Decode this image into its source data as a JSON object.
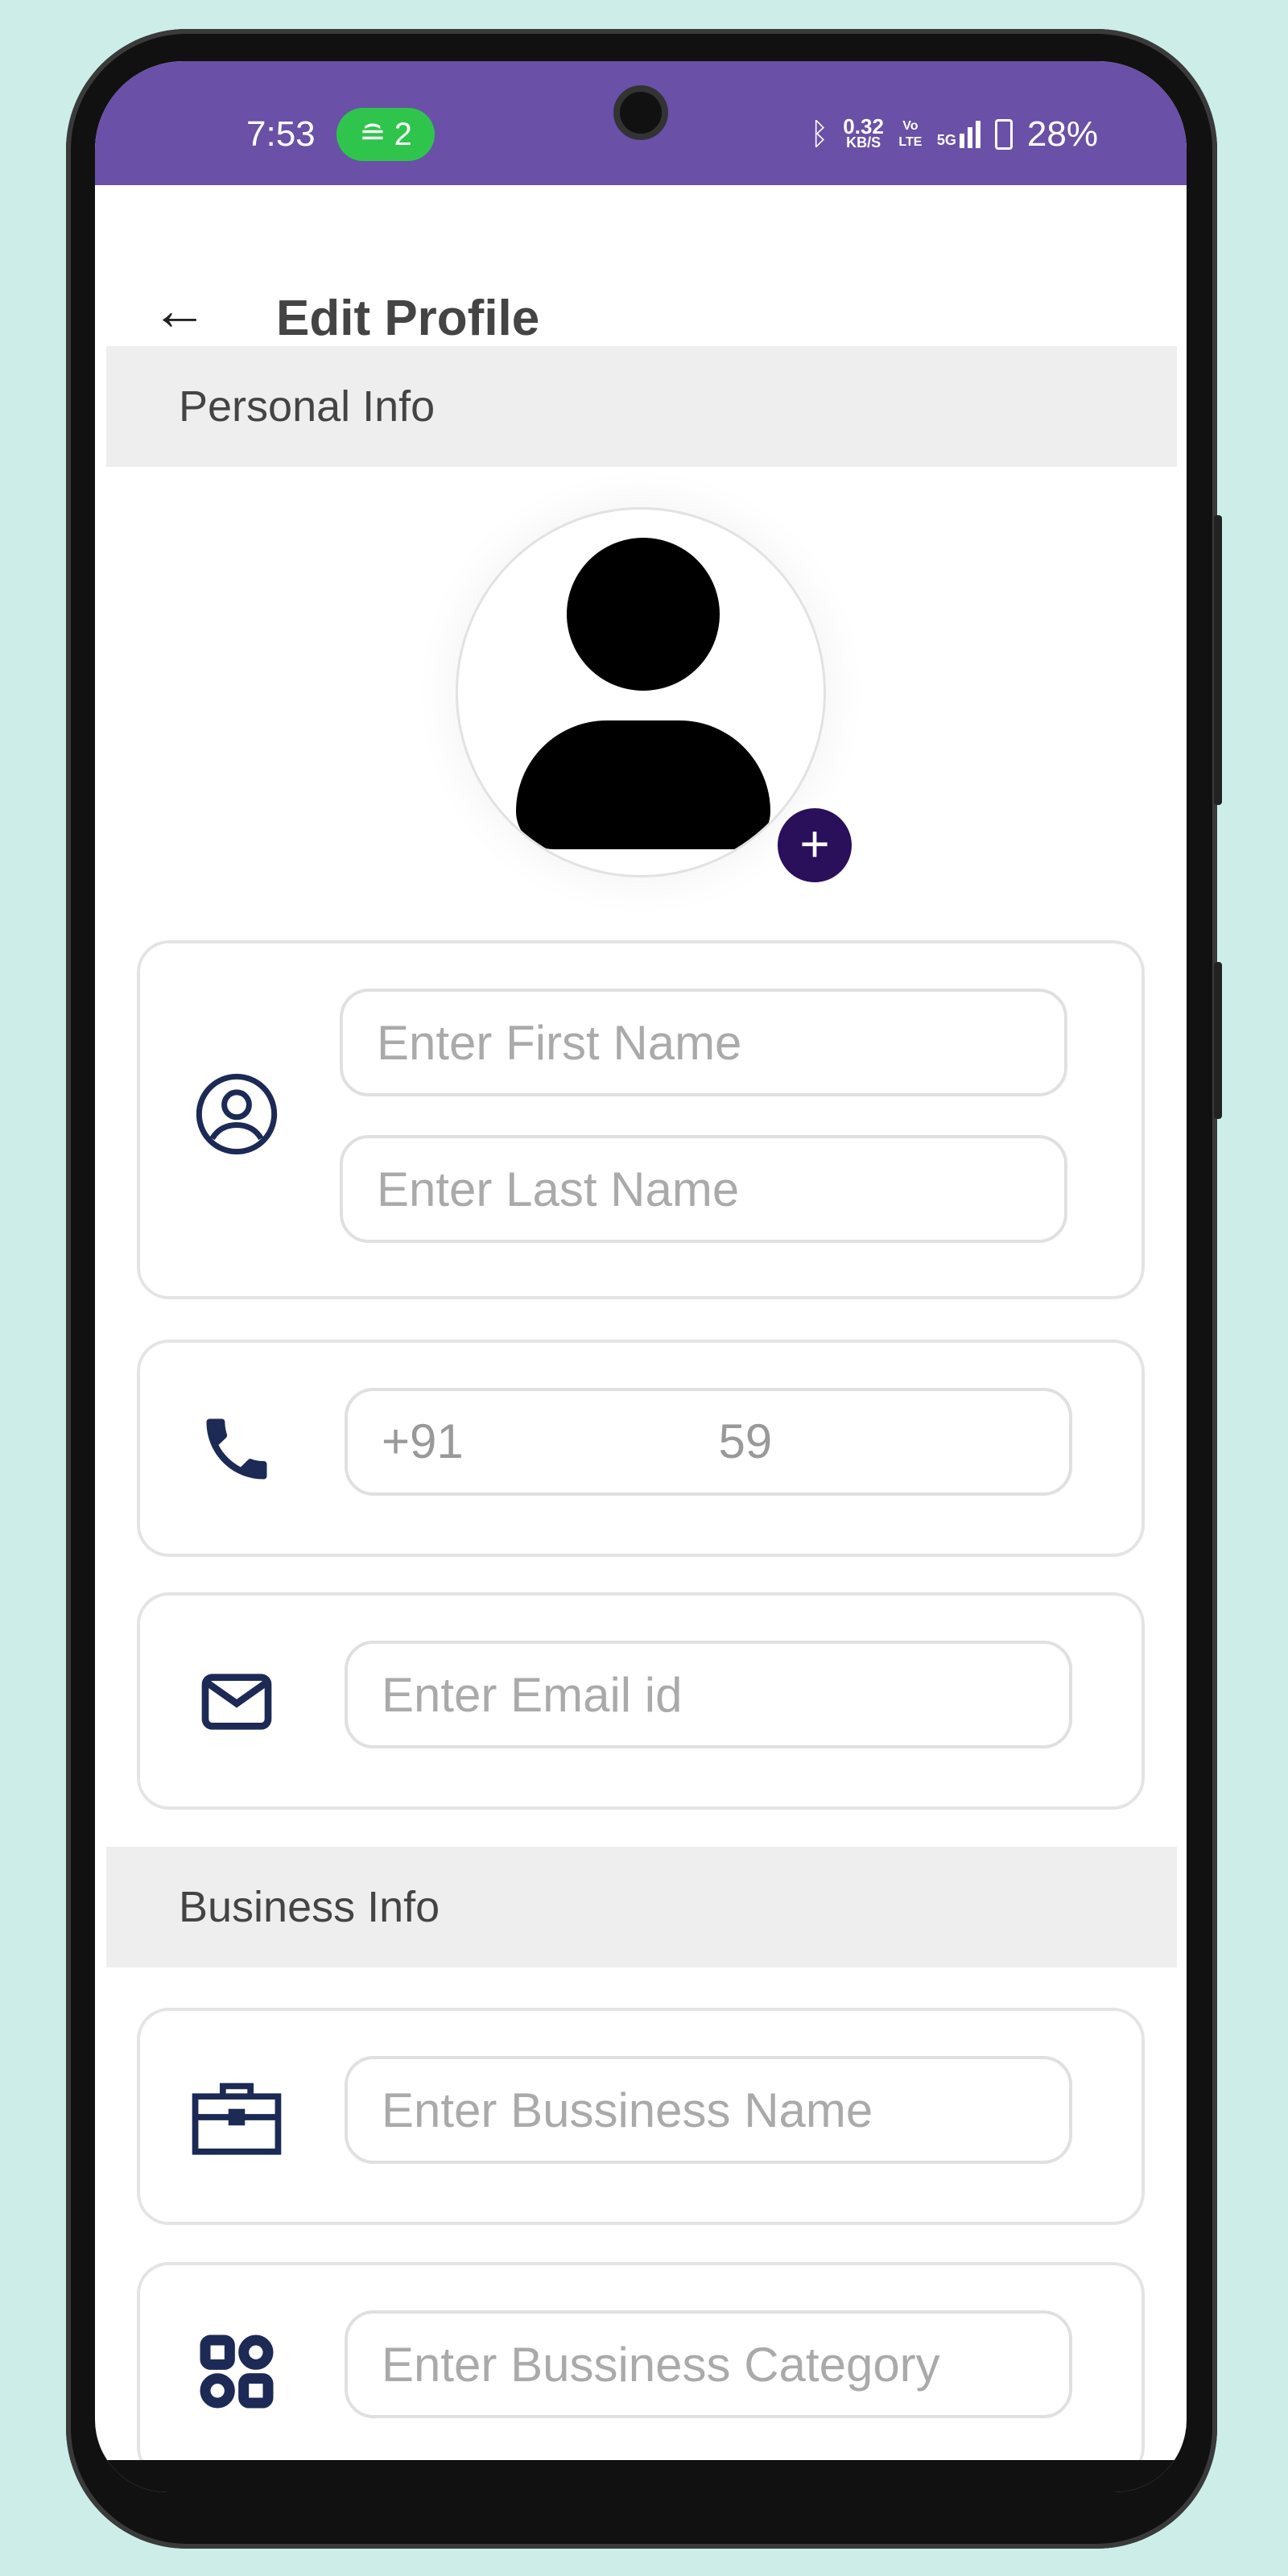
{
  "status_bar": {
    "time": "7:53",
    "hotspot_count": "2",
    "net_speed_value": "0.32",
    "net_speed_unit": "KB/S",
    "volte": "Vo LTE",
    "network": "5G",
    "battery": "28%",
    "color": "#6a50a7"
  },
  "header": {
    "back_icon": "arrow-left-icon",
    "title": "Edit Profile"
  },
  "personal_info": {
    "section_title": "Personal Info",
    "avatar_add_icon": "plus-icon",
    "first_name": {
      "placeholder": "Enter First Name",
      "value": ""
    },
    "last_name": {
      "placeholder": "Enter Last Name",
      "value": ""
    },
    "phone": {
      "code": "+91",
      "value": "59"
    },
    "email": {
      "placeholder": "Enter Email id",
      "value": ""
    }
  },
  "business_info": {
    "section_title": "Business Info",
    "business_name": {
      "placeholder": "Enter Bussiness Name",
      "value": ""
    },
    "business_category": {
      "placeholder": "Enter Bussiness Category",
      "value": ""
    }
  },
  "colors": {
    "accent": "#2a0f5a",
    "icon": "#1c2a55",
    "background": "#cdeee8"
  }
}
